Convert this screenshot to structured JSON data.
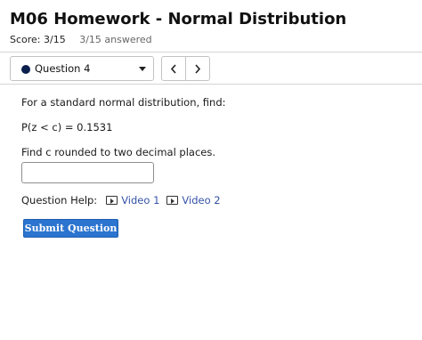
{
  "header": {
    "title": "M06 Homework - Normal Distribution",
    "score": "Score: 3/15",
    "answered": "3/15 answered"
  },
  "nav": {
    "question_selected": "Question 4",
    "dot_color": "#0b1f4d"
  },
  "question": {
    "prompt": "For a standard normal distribution, find:",
    "equation": "P(z < c) = 0.1531",
    "instruction": "Find c rounded to two decimal places.",
    "answer_value": "",
    "answer_placeholder": ""
  },
  "help": {
    "label": "Question Help:",
    "videos": [
      "Video 1",
      "Video 2"
    ]
  },
  "submit": {
    "label": "Submit Question",
    "color": "#2b74cf"
  }
}
